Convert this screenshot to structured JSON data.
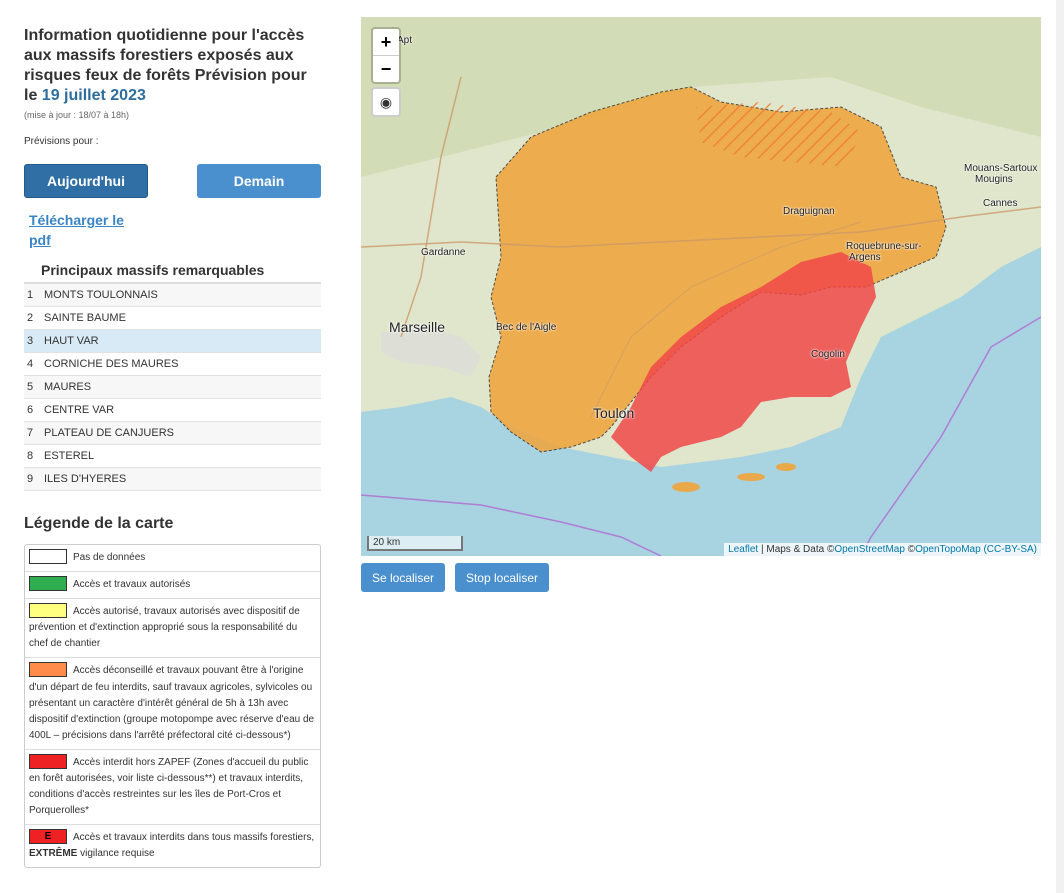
{
  "header": {
    "title": "Information quotidienne pour l'accès aux massifs forestiers exposés aux risques feux de forêts Prévision pour le ",
    "date": "19 juillet 2023",
    "updated": "(mise à jour : 18/07 à 18h)"
  },
  "forecast": {
    "label": "Prévisions pour :",
    "today": "Aujourd'hui",
    "tomorrow": "Demain"
  },
  "download_link": "Télécharger le pdf",
  "massifs": {
    "title": "Principaux massifs remarquables",
    "items": [
      {
        "num": "1",
        "name": "MONTS TOULONNAIS"
      },
      {
        "num": "2",
        "name": "SAINTE BAUME"
      },
      {
        "num": "3",
        "name": "HAUT VAR"
      },
      {
        "num": "4",
        "name": "CORNICHE DES MAURES"
      },
      {
        "num": "5",
        "name": "MAURES"
      },
      {
        "num": "6",
        "name": "CENTRE VAR"
      },
      {
        "num": "7",
        "name": "PLATEAU DE CANJUERS"
      },
      {
        "num": "8",
        "name": "ESTEREL"
      },
      {
        "num": "9",
        "name": "ILES D'HYERES"
      }
    ],
    "active_index": 2
  },
  "legend": {
    "title": "Légende de la carte",
    "items": [
      {
        "color": "#ffffff",
        "mark": "",
        "text": "Pas de données"
      },
      {
        "color": "#2fae4f",
        "mark": "",
        "text": "Accès et travaux autorisés"
      },
      {
        "color": "#ffff80",
        "mark": "",
        "text": "Accès autorisé, travaux autorisés avec dispositif de prévention et d'extinction approprié sous la responsabilité du chef de chantier"
      },
      {
        "color": "#ff8c4a",
        "mark": "",
        "text": "Accès déconseillé et travaux pouvant être à l'origine d'un départ de feu interdits, sauf travaux agricoles, sylvicoles ou présentant un caractère d'intérêt général de 5h à 13h avec dispositif d'extinction (groupe motopompe avec réserve d'eau de 400L – précisions dans l'arrêté préfectoral cité ci-dessous*)"
      },
      {
        "color": "#ee2222",
        "mark": "",
        "text": "Accès interdit hors ZAPEF (Zones d'accueil du public en forêt autorisées, voir liste ci-dessous**) et travaux interdits, conditions d'accès restreintes sur les îles de Port-Cros et Porquerolles*"
      },
      {
        "color": "#ee2222",
        "mark": "E",
        "text_before": "Accès et travaux interdits dans tous massifs forestiers, ",
        "text_bold": "EXTRÊME",
        "text_after": " vigilance requise"
      }
    ]
  },
  "map": {
    "zoom_in": "+",
    "zoom_out": "−",
    "locate_icon": "globe-icon",
    "scale": "20 km",
    "attribution": {
      "leaflet": "Leaflet",
      "sep": " | Maps & Data ©",
      "osm": "OpenStreetMap",
      "sep2": " ©",
      "otm": "OpenTopoMap",
      "license": "(CC-BY-SA)"
    },
    "labels": {
      "marseille": "Marseille",
      "toulon": "Toulon",
      "draguignan": "Draguignan",
      "cannes": "Cannes",
      "gardanne": "Gardanne",
      "mougins": "Mouans-Sartoux",
      "mougins2": "Mougins",
      "roquebrune": "Roquebrune-sur-",
      "argens": "Argens",
      "cogolin": "Cogolin",
      "apt": "Apt",
      "aigle": "Bec de l'Aigle"
    },
    "colors": {
      "sea": "#a8d3e0",
      "land": "#e4e8d0",
      "orange_zone": "#f0a43a",
      "red_zone": "#f05050"
    }
  },
  "buttons": {
    "locate": "Se localiser",
    "stop": "Stop localiser"
  }
}
